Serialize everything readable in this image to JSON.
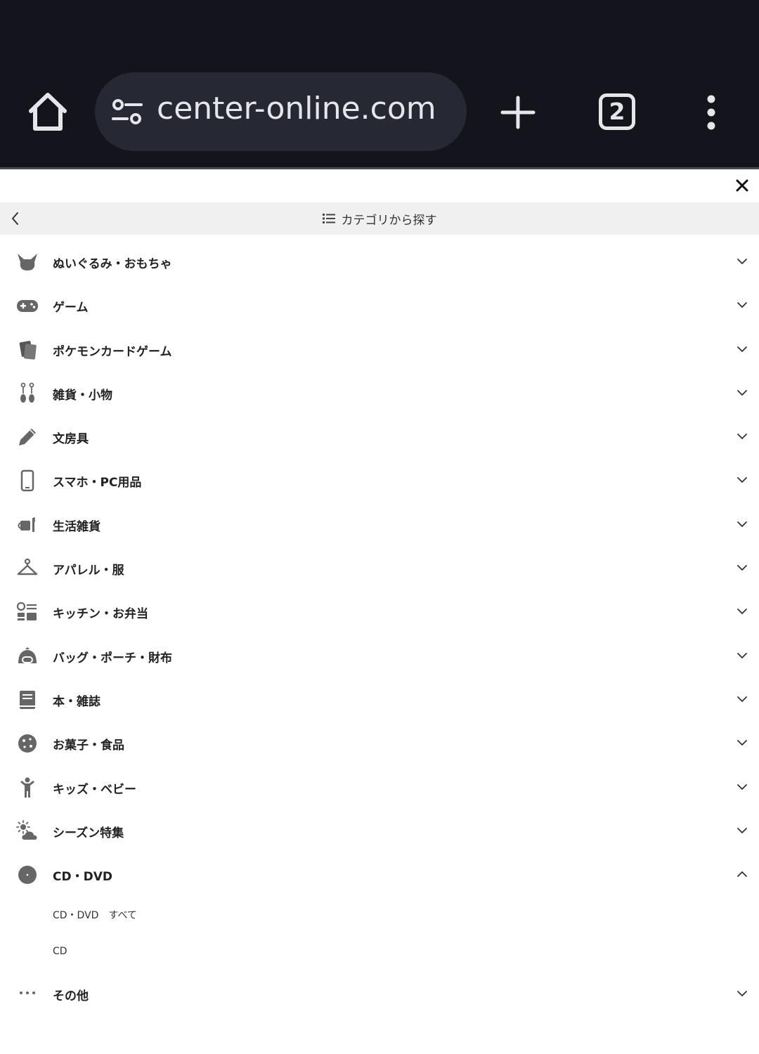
{
  "browser": {
    "url_text": "center-online.com",
    "tab_count": "2"
  },
  "menu": {
    "header_title": "カテゴリから探す",
    "categories": [
      {
        "label": "ぬいぐるみ・おもちゃ",
        "icon": "plush-icon",
        "expanded": false
      },
      {
        "label": "ゲーム",
        "icon": "gamepad-icon",
        "expanded": false
      },
      {
        "label": "ポケモンカードゲーム",
        "icon": "cards-icon",
        "expanded": false
      },
      {
        "label": "雑貨・小物",
        "icon": "earrings-icon",
        "expanded": false
      },
      {
        "label": "文房具",
        "icon": "pencil-icon",
        "expanded": false
      },
      {
        "label": "スマホ・PC用品",
        "icon": "smartphone-icon",
        "expanded": false
      },
      {
        "label": "生活雑貨",
        "icon": "household-icon",
        "expanded": false
      },
      {
        "label": "アパレル・服",
        "icon": "hanger-icon",
        "expanded": false
      },
      {
        "label": "キッチン・お弁当",
        "icon": "kitchen-icon",
        "expanded": false
      },
      {
        "label": "バッグ・ポーチ・財布",
        "icon": "bag-icon",
        "expanded": false
      },
      {
        "label": "本・雑誌",
        "icon": "book-icon",
        "expanded": false
      },
      {
        "label": "お菓子・食品",
        "icon": "cookie-icon",
        "expanded": false
      },
      {
        "label": "キッズ・ベビー",
        "icon": "kid-icon",
        "expanded": false
      },
      {
        "label": "シーズン特集",
        "icon": "weather-icon",
        "expanded": false
      },
      {
        "label": "CD・DVD",
        "icon": "disc-icon",
        "expanded": true
      },
      {
        "label": "その他",
        "icon": "more-horizontal-icon",
        "expanded": false
      }
    ],
    "cd_dvd_subitems": [
      "CD・DVD　すべて",
      "CD"
    ]
  },
  "colors": {
    "chrome_bg": "#13141c",
    "url_pill_bg": "#262833",
    "icon_gray": "#666666",
    "header_bg": "#f0f0f0"
  }
}
